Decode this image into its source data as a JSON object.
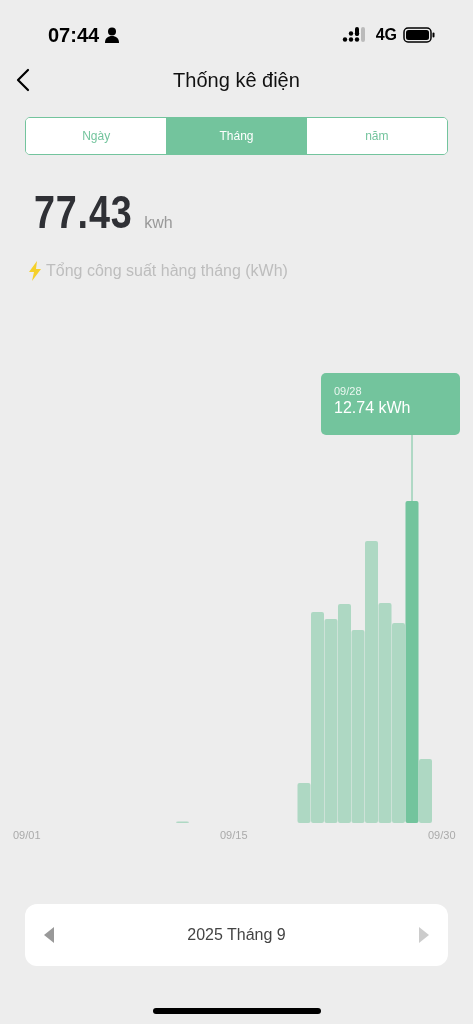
{
  "status_bar": {
    "time": "07:44",
    "network": "4G"
  },
  "header": {
    "title": "Thống kê điện"
  },
  "tabs": [
    {
      "label": "Ngày",
      "selected": false
    },
    {
      "label": "Tháng",
      "selected": true
    },
    {
      "label": "năm",
      "selected": false
    }
  ],
  "total": {
    "value": "77.43",
    "unit": "kwh"
  },
  "subtitle": "Tổng công suất hàng tháng (kWh)",
  "chart": {
    "tooltip": {
      "date": "09/28",
      "value": "12.74 kWh"
    },
    "x_labels": [
      "09/01",
      "09/15",
      "09/30"
    ]
  },
  "period": {
    "label": "2025 Tháng 9"
  }
}
